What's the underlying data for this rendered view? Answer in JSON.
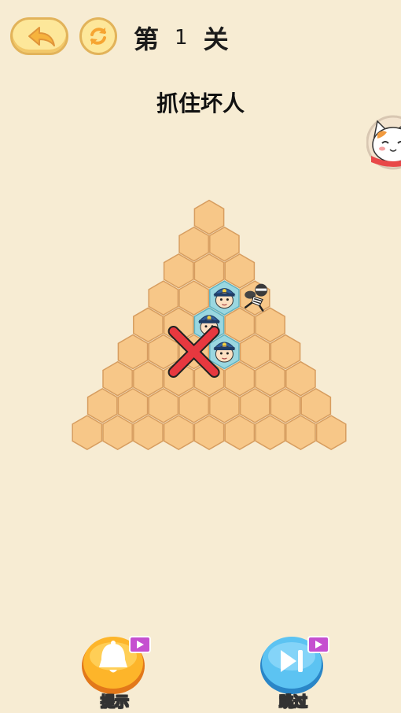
{
  "header": {
    "level_prefix": "第",
    "level_number": "1",
    "level_suffix": "关"
  },
  "task_text": "抓住坏人",
  "board": {
    "rows": 9,
    "tile_color": "#f7c788",
    "tile_border": "#d79d5f",
    "police_tile_color": "#9ad7e0",
    "police_positions": [
      [
        3,
        2
      ],
      [
        4,
        2
      ],
      [
        5,
        3
      ]
    ],
    "thief_position": [
      3,
      3
    ],
    "wrong_mark_position": [
      5,
      2
    ]
  },
  "buttons": {
    "hint_label": "提示",
    "skip_label": "跳过"
  },
  "icons": {
    "back": "back-arrow-icon",
    "refresh": "refresh-icon",
    "hint": "bell-icon",
    "skip": "skip-forward-icon",
    "video": "video-ad-icon"
  },
  "colors": {
    "background": "#f7ecd3",
    "hint_button": "#f9a21b",
    "skip_button": "#4fb6ec",
    "wrong_mark": "#e7383f"
  }
}
